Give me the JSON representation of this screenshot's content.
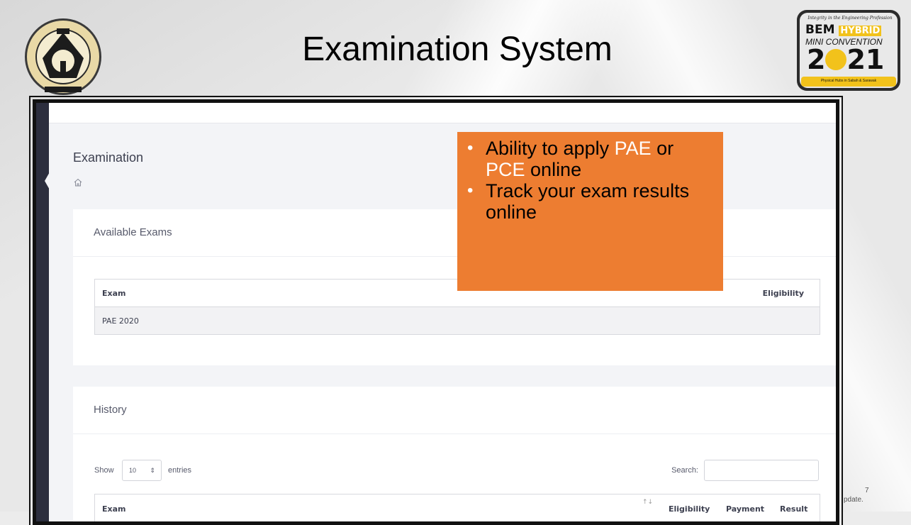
{
  "slide": {
    "title": "Examination System",
    "footnote_line1": "7",
    "footnote_line2": "pdate."
  },
  "logos": {
    "left": "Lembaga Jurutera Malaysia seal",
    "right_tagline": "Integrity in the Engineering Profession",
    "right_bem": "BEM",
    "right_hybrid": "HYBRID",
    "right_mini": "MINI CONVENTION",
    "right_year_a": "2",
    "right_year_b": "21",
    "right_sub": "Physical Hubs in Sabah & Sarawak"
  },
  "callout": {
    "bullet1_a": "Ability to apply ",
    "bullet1_hl1": "PAE",
    "bullet1_b": " or ",
    "bullet1_hl2": "PCE",
    "bullet1_c": " online",
    "bullet2": "Track your exam results online",
    "bg_color": "#ed7d31"
  },
  "app": {
    "page_title": "Examination",
    "breadcrumb_icon": "home-icon",
    "available_exams": {
      "title": "Available Exams",
      "columns": [
        "Exam",
        "Eligibility"
      ],
      "rows": [
        [
          "PAE 2020",
          ""
        ]
      ]
    },
    "history": {
      "title": "History",
      "show_label": "Show",
      "entries_value": "10",
      "entries_label": "entries",
      "search_label": "Search:",
      "search_value": "",
      "columns": [
        "Exam",
        "Eligibility",
        "Payment",
        "Result"
      ],
      "sort_icon": "↑↓"
    }
  }
}
